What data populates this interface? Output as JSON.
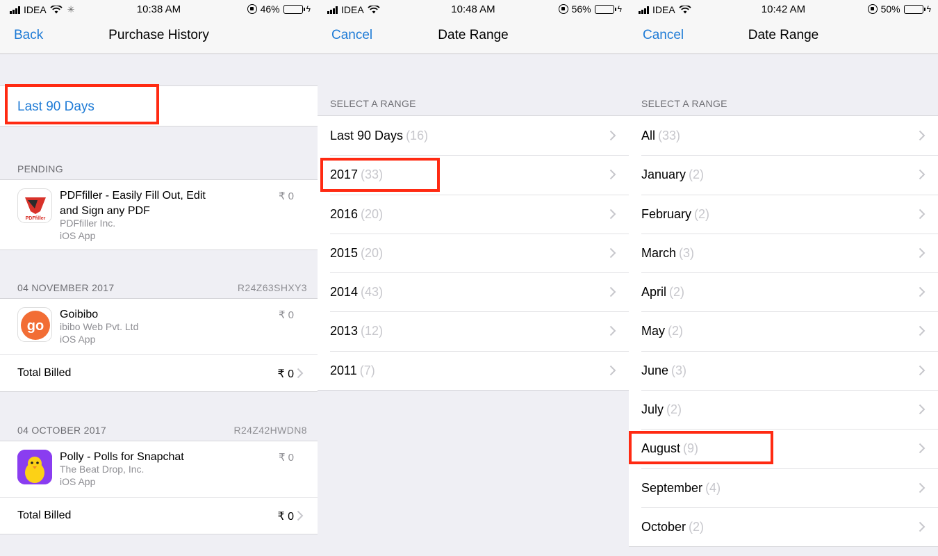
{
  "colors": {
    "accent": "#1e7bd6",
    "highlight": "#ff2a12",
    "battery": "#f7c600"
  },
  "panels": [
    {
      "status": {
        "carrier": "IDEA",
        "time": "10:38 AM",
        "battery": "46%",
        "battery_level": 0.46
      },
      "nav": {
        "left": "Back",
        "title": "Purchase History"
      },
      "filter_label": "Last 90 Days",
      "sections": [
        {
          "header": "PENDING",
          "code": "",
          "app": {
            "name": "PDFfiller - Easily Fill Out, Edit and Sign any PDF",
            "developer": "PDFfiller Inc.",
            "type": "iOS App",
            "price": "₹ 0",
            "icon": "pdffiller-icon",
            "icon_text": "PDFfiller"
          }
        },
        {
          "header": "04 NOVEMBER 2017",
          "code": "R24Z63SHXY3",
          "app": {
            "name": "Goibibo",
            "developer": "ibibo Web Pvt. Ltd",
            "type": "iOS App",
            "price": "₹ 0",
            "icon": "goibibo-icon",
            "icon_text": "go"
          },
          "total_label": "Total Billed",
          "total_value": "₹ 0"
        },
        {
          "header": "04 OCTOBER 2017",
          "code": "R24Z42HWDN8",
          "app": {
            "name": "Polly - Polls for Snapchat",
            "developer": "The Beat Drop, Inc.",
            "type": "iOS App",
            "price": "₹ 0",
            "icon": "polly-icon"
          },
          "total_label": "Total Billed",
          "total_value": "₹ 0"
        }
      ]
    },
    {
      "status": {
        "carrier": "IDEA",
        "time": "10:48 AM",
        "battery": "56%",
        "battery_level": 0.56
      },
      "nav": {
        "left": "Cancel",
        "title": "Date Range"
      },
      "section_header": "SELECT A RANGE",
      "items": [
        {
          "label": "Last 90 Days",
          "count": "(16)"
        },
        {
          "label": "2017",
          "count": "(33)"
        },
        {
          "label": "2016",
          "count": "(20)"
        },
        {
          "label": "2015",
          "count": "(20)"
        },
        {
          "label": "2014",
          "count": "(43)"
        },
        {
          "label": "2013",
          "count": "(12)"
        },
        {
          "label": "2011",
          "count": "(7)"
        }
      ]
    },
    {
      "status": {
        "carrier": "IDEA",
        "time": "10:42 AM",
        "battery": "50%",
        "battery_level": 0.5
      },
      "nav": {
        "left": "Cancel",
        "title": "Date Range"
      },
      "section_header": "SELECT A RANGE",
      "items": [
        {
          "label": "All",
          "count": "(33)"
        },
        {
          "label": "January",
          "count": "(2)"
        },
        {
          "label": "February",
          "count": "(2)"
        },
        {
          "label": "March",
          "count": "(3)"
        },
        {
          "label": "April",
          "count": "(2)"
        },
        {
          "label": "May",
          "count": "(2)"
        },
        {
          "label": "June",
          "count": "(3)"
        },
        {
          "label": "July",
          "count": "(2)"
        },
        {
          "label": "August",
          "count": "(9)"
        },
        {
          "label": "September",
          "count": "(4)"
        },
        {
          "label": "October",
          "count": "(2)"
        }
      ]
    }
  ]
}
